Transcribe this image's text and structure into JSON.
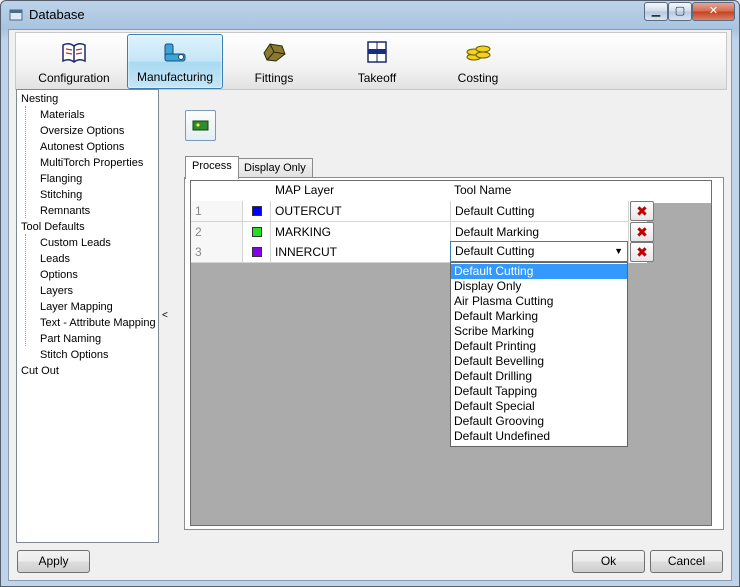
{
  "window": {
    "title": "Database"
  },
  "toolbar": {
    "items": [
      {
        "label": "Configuration",
        "icon": "book-icon"
      },
      {
        "label": "Manufacturing",
        "icon": "manufacturing-icon",
        "active": true
      },
      {
        "label": "Fittings",
        "icon": "fittings-icon"
      },
      {
        "label": "Takeoff",
        "icon": "takeoff-icon"
      },
      {
        "label": "Costing",
        "icon": "coins-icon"
      }
    ]
  },
  "tree": {
    "items": [
      {
        "label": "Nesting",
        "level": 0
      },
      {
        "label": "Materials",
        "level": 1
      },
      {
        "label": "Oversize Options",
        "level": 1
      },
      {
        "label": "Autonest Options",
        "level": 1
      },
      {
        "label": "MultiTorch Properties",
        "level": 1
      },
      {
        "label": "Flanging",
        "level": 1
      },
      {
        "label": "Stitching",
        "level": 1
      },
      {
        "label": "Remnants",
        "level": 1
      },
      {
        "label": "Tool Defaults",
        "level": 0
      },
      {
        "label": "Custom Leads",
        "level": 1
      },
      {
        "label": "Leads",
        "level": 1
      },
      {
        "label": "Options",
        "level": 1
      },
      {
        "label": "Layers",
        "level": 1,
        "selected": true
      },
      {
        "label": "Layer Mapping",
        "level": 1
      },
      {
        "label": "Text - Attribute Mapping",
        "level": 1
      },
      {
        "label": "Part Naming",
        "level": 1
      },
      {
        "label": "Stitch Options",
        "level": 1
      },
      {
        "label": "Cut Out",
        "level": 0
      }
    ]
  },
  "splitter": {
    "arrow": "<"
  },
  "tabs": [
    {
      "label": "Process",
      "active": true
    },
    {
      "label": "Display Only"
    }
  ],
  "grid": {
    "headers": {
      "layer": "MAP Layer",
      "tool": "Tool Name"
    },
    "rows": [
      {
        "num": "1",
        "color": "#0000ff",
        "layer": "OUTERCUT",
        "tool": "Default Cutting"
      },
      {
        "num": "2",
        "color": "#22dd22",
        "layer": "MARKING",
        "tool": "Default Marking"
      },
      {
        "num": "3",
        "color": "#8800ee",
        "layer": "INNERCUT",
        "tool": "Default Cutting"
      }
    ],
    "delete_icon": "delete-x-icon"
  },
  "dropdown": {
    "selected": "Default Cutting",
    "options": [
      "Default Cutting",
      "Display Only",
      "Air Plasma Cutting",
      "Default Marking",
      "Scribe Marking",
      "Default Printing",
      "Default Bevelling",
      "Default Drilling",
      "Default Tapping",
      "Default Special",
      "Default Grooving",
      "Default Undefined"
    ]
  },
  "buttons": {
    "apply": "Apply",
    "ok": "Ok",
    "cancel": "Cancel"
  },
  "colors": {
    "selection": "#3399ff",
    "delete": "#c00000",
    "accent": "#3c7fb1"
  }
}
